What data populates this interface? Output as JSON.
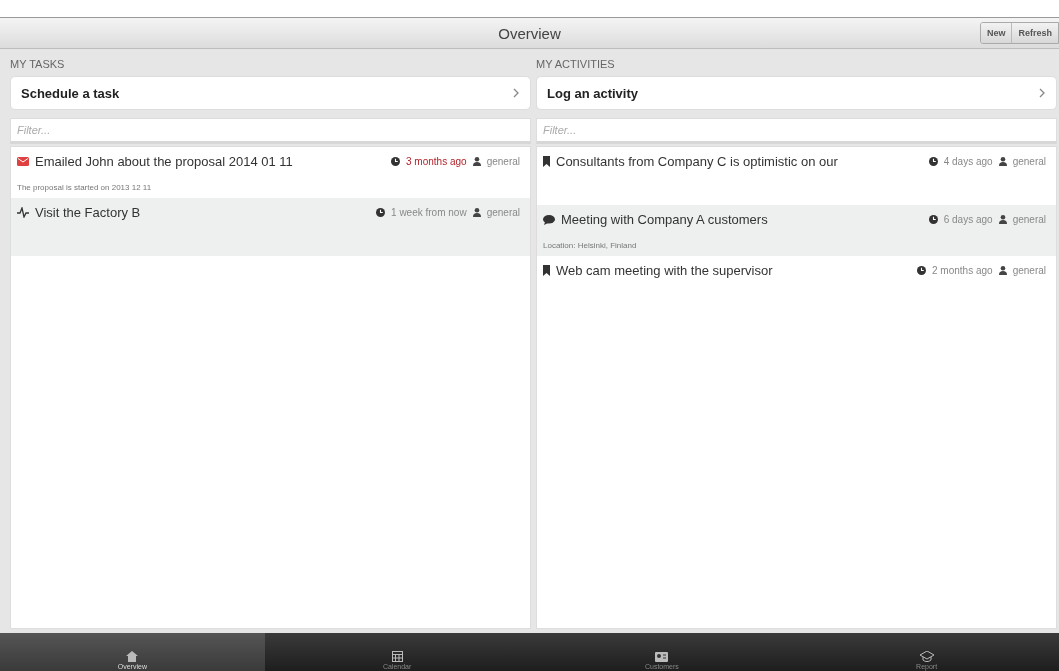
{
  "header": {
    "title": "Overview",
    "buttons": [
      "New",
      "Refresh"
    ]
  },
  "panels": [
    {
      "heading": "MY TASKS",
      "action": "Schedule a task",
      "filter": {
        "placeholder": "Filter..."
      },
      "items": [
        {
          "kind": "email",
          "title": "Emailed John about the proposal 2014 01 11",
          "when": "3 months ago",
          "overdue": true,
          "owner": "general",
          "note": "The proposal is started on 2013 12 11"
        },
        {
          "kind": "task",
          "title": "Visit the Factory B",
          "when": "1 week from now",
          "overdue": false,
          "owner": "general"
        }
      ]
    },
    {
      "heading": "MY ACTIVITIES",
      "action": "Log an activity",
      "filter": {
        "placeholder": "Filter..."
      },
      "items": [
        {
          "kind": "bookmark",
          "title": "Consultants from Company C is optimistic on our",
          "when": "4 days ago",
          "overdue": false,
          "owner": "general"
        },
        {
          "kind": "meeting",
          "title": "Meeting with Company A customers",
          "when": "6 days ago",
          "overdue": false,
          "owner": "general",
          "note": "Location: Helsinki, Finland"
        },
        {
          "kind": "bookmark",
          "title": "Web cam meeting with the supervisor",
          "when": "2 months ago",
          "overdue": false,
          "owner": "general"
        }
      ]
    }
  ],
  "tab_bar": [
    {
      "kind": "home",
      "label": "Overview",
      "selected": true
    },
    {
      "kind": "calendar",
      "label": "Calendar",
      "selected": false
    },
    {
      "kind": "customers",
      "label": "Customers",
      "selected": false
    },
    {
      "kind": "report",
      "label": "Report",
      "selected": false
    }
  ]
}
